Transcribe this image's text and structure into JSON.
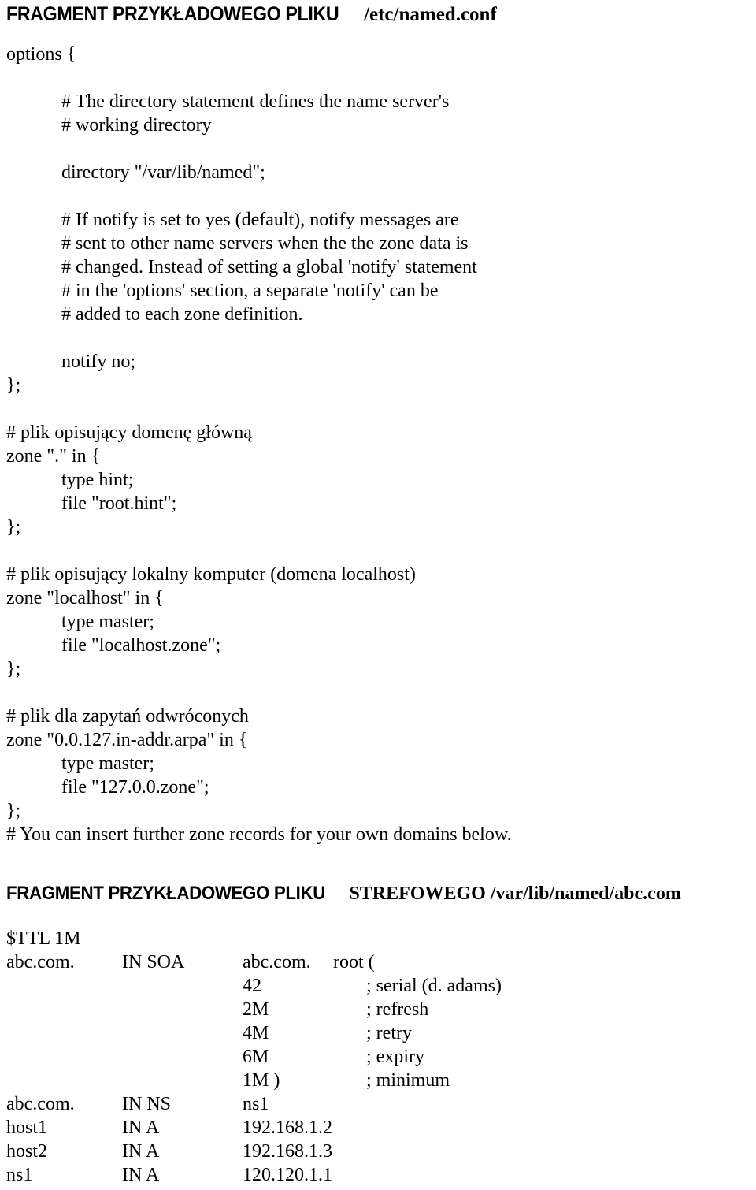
{
  "document": {
    "headings": [
      {
        "id": "heading-1",
        "sans_part": "FRAGMENT PRZYKŁADOWEGO PLIKU",
        "serif_part": "/etc/named.conf"
      },
      {
        "id": "heading-2",
        "sans_part": "FRAGMENT PRZYKŁADOWEGO PLIKU",
        "serif_part": "STREFOWEGO /var/lib/named/abc.com"
      }
    ],
    "named_conf_lines": [
      {
        "text": "options {",
        "indent": 0
      },
      {
        "text": "",
        "indent": 0
      },
      {
        "text": "# The directory statement defines the name server's",
        "indent": 1
      },
      {
        "text": "# working directory",
        "indent": 1
      },
      {
        "text": "",
        "indent": 0
      },
      {
        "text": "directory \"/var/lib/named\";",
        "indent": 1
      },
      {
        "text": "",
        "indent": 0
      },
      {
        "text": "# If notify is set to yes (default), notify messages are",
        "indent": 1
      },
      {
        "text": "# sent to other name servers when the the zone data is",
        "indent": 1
      },
      {
        "text": "# changed. Instead of setting a global 'notify' statement",
        "indent": 1
      },
      {
        "text": "# in the 'options' section, a separate 'notify' can be",
        "indent": 1
      },
      {
        "text": "# added to each zone definition.",
        "indent": 1
      },
      {
        "text": "",
        "indent": 0
      },
      {
        "text": "notify no;",
        "indent": 1
      },
      {
        "text": "};",
        "indent": 0
      },
      {
        "text": "",
        "indent": 0
      },
      {
        "text": "# plik opisujący domenę główną",
        "indent": 0
      },
      {
        "text": "zone \".\" in {",
        "indent": 0
      },
      {
        "text": "type hint;",
        "indent": 1
      },
      {
        "text": "file \"root.hint\";",
        "indent": 1
      },
      {
        "text": "};",
        "indent": 0
      },
      {
        "text": "",
        "indent": 0
      },
      {
        "text": "# plik opisujący lokalny komputer (domena localhost)",
        "indent": 0
      },
      {
        "text": "zone \"localhost\" in {",
        "indent": 0
      },
      {
        "text": "type master;",
        "indent": 1
      },
      {
        "text": "file \"localhost.zone\";",
        "indent": 1
      },
      {
        "text": "};",
        "indent": 0
      },
      {
        "text": "",
        "indent": 0
      },
      {
        "text": "# plik dla zapytań odwróconych",
        "indent": 0
      },
      {
        "text": "zone \"0.0.127.in-addr.arpa\" in {",
        "indent": 0
      },
      {
        "text": "type master;",
        "indent": 1
      },
      {
        "text": "file \"127.0.0.zone\";",
        "indent": 1
      },
      {
        "text": "};",
        "indent": 0
      },
      {
        "text": "# You can insert further zone records for your own domains below.",
        "indent": 0
      }
    ],
    "zone_file_rows": [
      {
        "name": "$TTL 1M",
        "type": "",
        "value": "",
        "extra": "",
        "comment": ""
      },
      {
        "name": "abc.com.",
        "type": "IN SOA",
        "value": "abc.com.",
        "extra": "root (",
        "comment": ""
      },
      {
        "name": "",
        "type": "",
        "value": "42",
        "extra": "",
        "comment": "; serial (d. adams)"
      },
      {
        "name": "",
        "type": "",
        "value": "2M",
        "extra": "",
        "comment": "; refresh"
      },
      {
        "name": "",
        "type": "",
        "value": "4M",
        "extra": "",
        "comment": "; retry"
      },
      {
        "name": "",
        "type": "",
        "value": "6M",
        "extra": "",
        "comment": "; expiry"
      },
      {
        "name": "",
        "type": "",
        "value": "1M )",
        "extra": "",
        "comment": "; minimum"
      },
      {
        "name": "abc.com.",
        "type": "IN NS",
        "value": "ns1",
        "extra": "",
        "comment": ""
      },
      {
        "name": "host1",
        "type": "IN A",
        "value": "192.168.1.2",
        "extra": "",
        "comment": ""
      },
      {
        "name": "host2",
        "type": "IN A",
        "value": "192.168.1.3",
        "extra": "",
        "comment": ""
      },
      {
        "name": "ns1",
        "type": "IN A",
        "value": "120.120.1.1",
        "extra": "",
        "comment": ""
      }
    ]
  },
  "colors": {
    "background": "#ffffff",
    "text": "#000000"
  }
}
